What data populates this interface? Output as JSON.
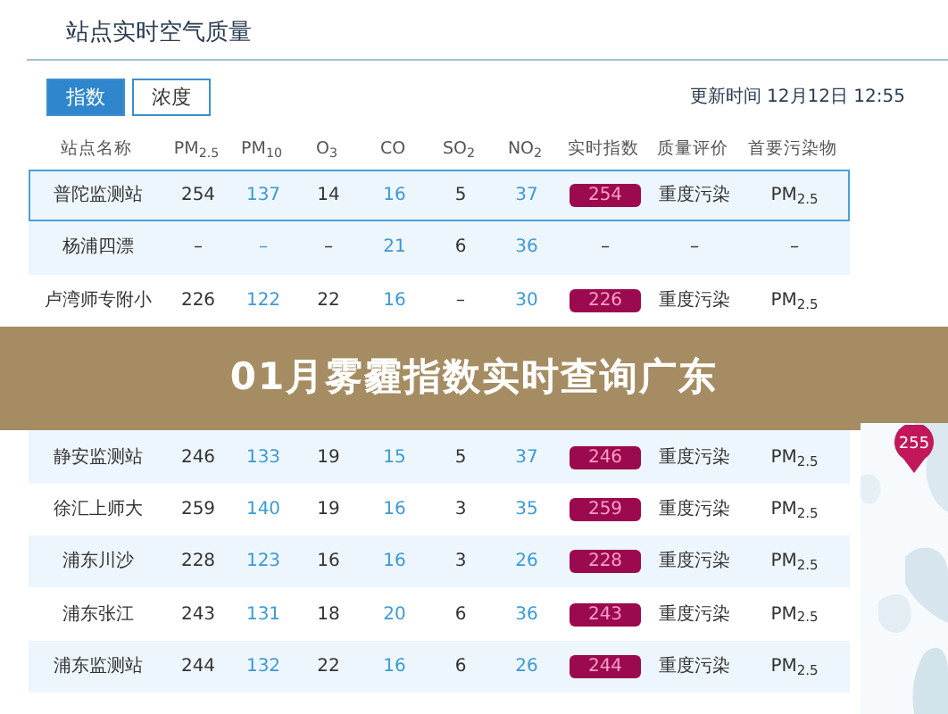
{
  "page_title": "站点实时空气质量",
  "tabs": [
    {
      "label": "指数",
      "selected": true
    },
    {
      "label": "浓度",
      "selected": false
    }
  ],
  "update_time": "更新时间 12月12日 12:55",
  "columns": [
    {
      "label": "站点名称",
      "kind": "text"
    },
    {
      "label": "PM$_{2.5}$",
      "kind": "text"
    },
    {
      "label": "PM$_{10}$",
      "kind": "link"
    },
    {
      "label": "O$_{3}$",
      "kind": "text"
    },
    {
      "label": "CO",
      "kind": "link"
    },
    {
      "label": "SO$_{2}$",
      "kind": "text"
    },
    {
      "label": "NO$_{2}$",
      "kind": "link"
    },
    {
      "label": "实时指数",
      "kind": "badge"
    },
    {
      "label": "质量评价",
      "kind": "text"
    },
    {
      "label": "首要污染物",
      "kind": "text"
    }
  ],
  "rows_above": [
    {
      "selected": true,
      "badge": true,
      "cells": [
        "普陀监测站",
        "254",
        "137",
        "14",
        "16",
        "5",
        "37",
        "254",
        "重度污染",
        "PM$_{2.5}$"
      ]
    },
    {
      "selected": false,
      "badge": false,
      "cells": [
        "杨浦四漂",
        "–",
        "–",
        "–",
        "21",
        "6",
        "36",
        "–",
        "–",
        "–"
      ]
    },
    {
      "selected": false,
      "badge": true,
      "cells": [
        "卢湾师专附小",
        "226",
        "122",
        "22",
        "16",
        "–",
        "30",
        "226",
        "重度污染",
        "PM$_{2.5}$"
      ]
    }
  ],
  "banner": {
    "title": "01月雾霾指数实时查询广东"
  },
  "rows_below": [
    {
      "selected": false,
      "badge": true,
      "cells": [
        "静安监测站",
        "246",
        "133",
        "19",
        "15",
        "5",
        "37",
        "246",
        "重度污染",
        "PM$_{2.5}$"
      ]
    },
    {
      "selected": false,
      "badge": true,
      "cells": [
        "徐汇上师大",
        "259",
        "140",
        "19",
        "16",
        "3",
        "35",
        "259",
        "重度污染",
        "PM$_{2.5}$"
      ]
    },
    {
      "selected": false,
      "badge": true,
      "cells": [
        "浦东川沙",
        "228",
        "123",
        "16",
        "16",
        "3",
        "26",
        "228",
        "重度污染",
        "PM$_{2.5}$"
      ]
    },
    {
      "selected": false,
      "badge": true,
      "cells": [
        "浦东张江",
        "243",
        "131",
        "18",
        "20",
        "6",
        "36",
        "243",
        "重度污染",
        "PM$_{2.5}$"
      ]
    },
    {
      "selected": false,
      "badge": true,
      "cells": [
        "浦东监测站",
        "244",
        "132",
        "22",
        "16",
        "6",
        "26",
        "244",
        "重度污染",
        "PM$_{2.5}$"
      ]
    }
  ],
  "map": {
    "kind": "picture",
    "pin": "255"
  }
}
